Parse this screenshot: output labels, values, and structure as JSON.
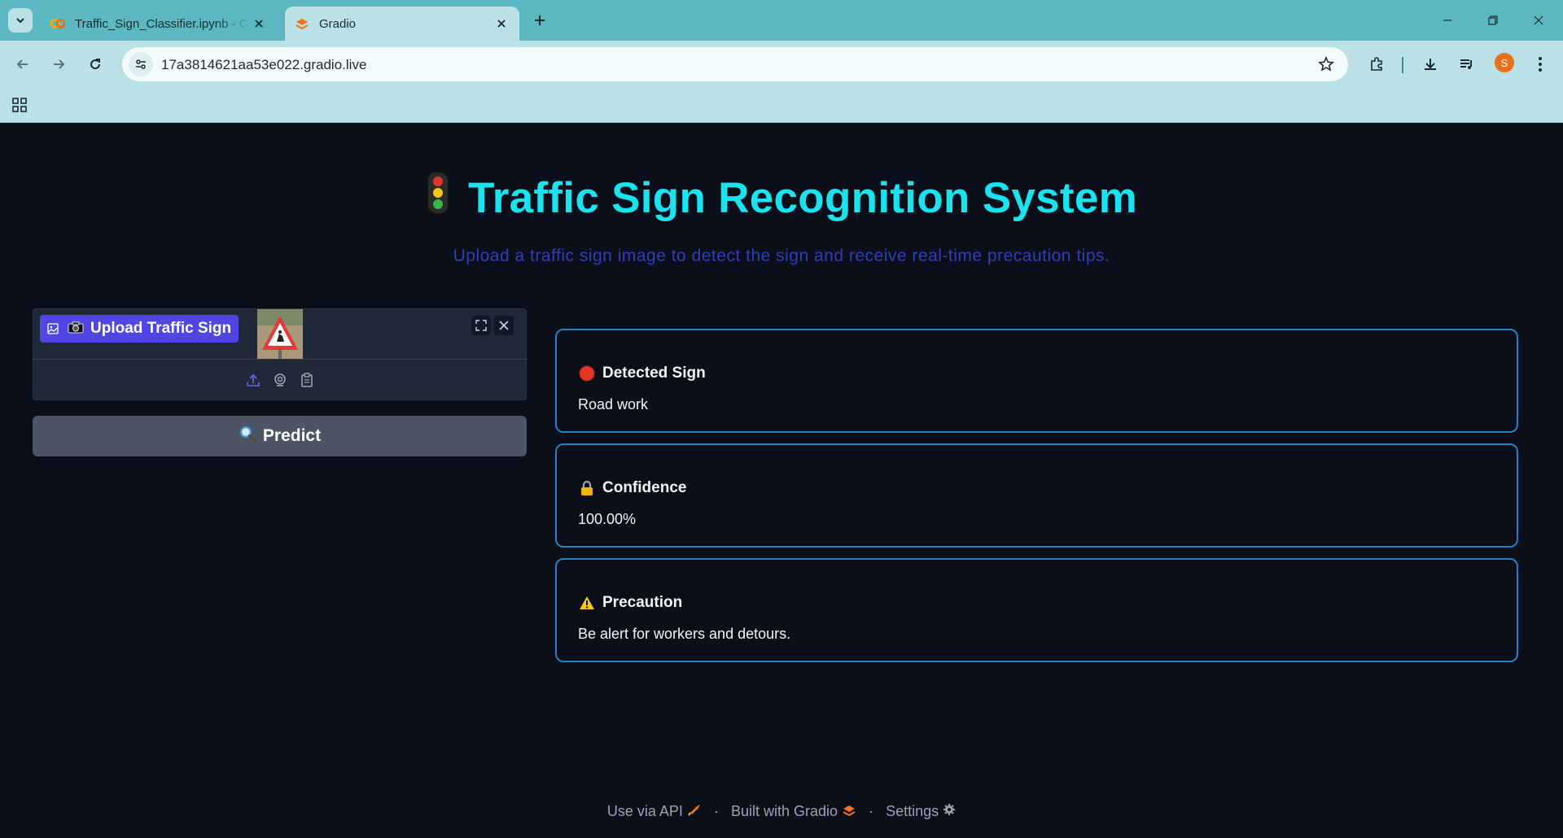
{
  "browser": {
    "tabs": [
      {
        "title": "Traffic_Sign_Classifier.ipynb - Colab",
        "active": false
      },
      {
        "title": "Gradio",
        "active": true
      }
    ],
    "url": "17a3814621aa53e022.gradio.live",
    "profile_initial": "S",
    "colors": {
      "tabbar": "#5bb8c3",
      "toolbar": "#b9e1e6"
    }
  },
  "app": {
    "title": "Traffic Sign Recognition System",
    "subtitle": "Upload a traffic sign image to detect the sign and receive real-time precaution tips.",
    "upload": {
      "label": "Upload Traffic Sign"
    },
    "predict": {
      "label": "Predict",
      "icon": "magnifier-icon"
    },
    "results": [
      {
        "emoji": "red-circle-icon",
        "title": "Detected Sign",
        "value": "Road work"
      },
      {
        "emoji": "lock-icon",
        "title": "Confidence",
        "value": "100.00%"
      },
      {
        "emoji": "warning-icon",
        "title": "Precaution",
        "value": "Be alert for workers and detours."
      }
    ],
    "colors": {
      "title": "#19e3ee",
      "subtitle": "#2f3fb7",
      "accent": "#4f46e5",
      "card_border": "#2680c2",
      "background": "#0b0f19"
    }
  },
  "footer": {
    "api": "Use via API",
    "built": "Built with Gradio",
    "settings": "Settings"
  }
}
